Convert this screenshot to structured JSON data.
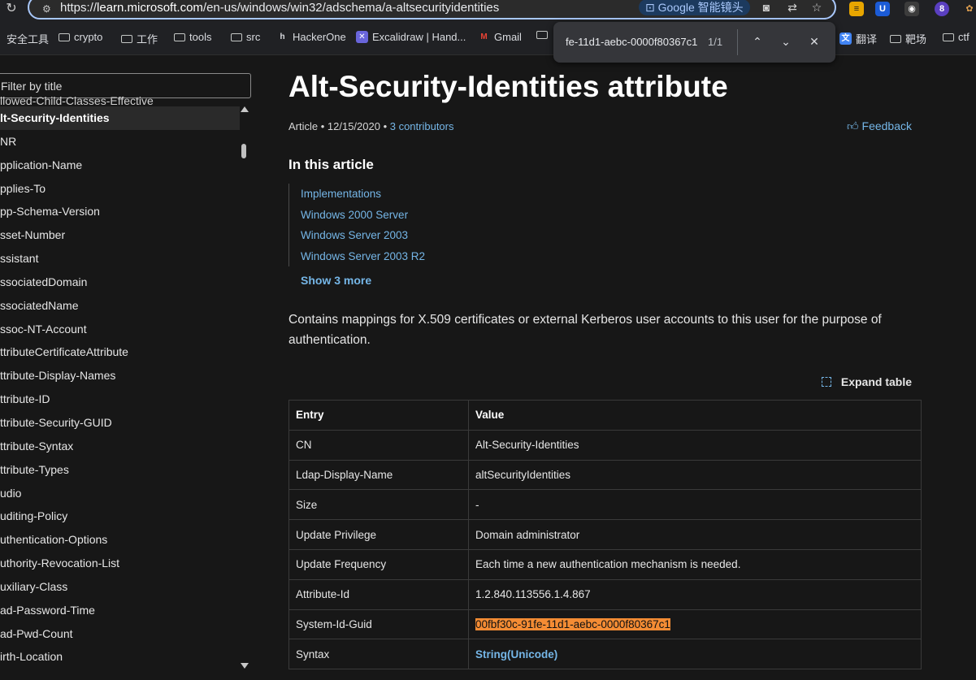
{
  "browser": {
    "url_prefix": "https://",
    "url_host": "learn.microsoft.com",
    "url_path": "/en-us/windows/win32/adschema/a-altsecurityidentities",
    "lens_label": "Google 智能镜头",
    "extension_badge": "8",
    "bookmarks": [
      {
        "label": "安全工具",
        "type": "text"
      },
      {
        "label": "crypto",
        "type": "folder"
      },
      {
        "label": "工作",
        "type": "folder"
      },
      {
        "label": "tools",
        "type": "folder"
      },
      {
        "label": "src",
        "type": "folder"
      },
      {
        "label": "HackerOne",
        "type": "h1"
      },
      {
        "label": "Excalidraw | Hand...",
        "type": "excalidraw"
      },
      {
        "label": "Gmail",
        "type": "gmail"
      },
      {
        "label": "",
        "type": "folder"
      },
      {
        "label": "翻译",
        "type": "translate"
      },
      {
        "label": "靶场",
        "type": "folder"
      },
      {
        "label": "ctf",
        "type": "folder"
      }
    ]
  },
  "find": {
    "query": "fe-11d1-aebc-0000f80367c1",
    "count": "1/1"
  },
  "toc": {
    "filter_placeholder": "Filter by title",
    "top_partial": "llowed-Child-Classes-Effective",
    "items": [
      {
        "label": "lt-Security-Identities",
        "active": true
      },
      {
        "label": "NR"
      },
      {
        "label": "pplication-Name"
      },
      {
        "label": "pplies-To"
      },
      {
        "label": "pp-Schema-Version"
      },
      {
        "label": "sset-Number"
      },
      {
        "label": "ssistant"
      },
      {
        "label": "ssociatedDomain"
      },
      {
        "label": "ssociatedName"
      },
      {
        "label": "ssoc-NT-Account"
      },
      {
        "label": "ttributeCertificateAttribute"
      },
      {
        "label": "ttribute-Display-Names"
      },
      {
        "label": "ttribute-ID"
      },
      {
        "label": "ttribute-Security-GUID"
      },
      {
        "label": "ttribute-Syntax"
      },
      {
        "label": "ttribute-Types"
      },
      {
        "label": "udio"
      },
      {
        "label": "uditing-Policy"
      },
      {
        "label": "uthentication-Options"
      },
      {
        "label": "uthority-Revocation-List"
      },
      {
        "label": "uxiliary-Class"
      },
      {
        "label": "ad-Password-Time"
      },
      {
        "label": "ad-Pwd-Count"
      },
      {
        "label": "irth-Location"
      }
    ]
  },
  "article": {
    "title": "Alt-Security-Identities attribute",
    "meta_prefix": "Article • 12/15/2020 • ",
    "contributors": "3 contributors",
    "feedback": "Feedback",
    "in_this_article": "In this article",
    "toc_links": [
      "Implementations",
      "Windows 2000 Server",
      "Windows Server 2003",
      "Windows Server 2003 R2"
    ],
    "show_more": "Show 3 more",
    "description": "Contains mappings for X.509 certificates or external Kerberos user accounts to this user for the purpose of authentication.",
    "expand_table": "Expand table",
    "table": {
      "headers": [
        "Entry",
        "Value"
      ],
      "rows": [
        {
          "entry": "CN",
          "value": "Alt-Security-Identities"
        },
        {
          "entry": "Ldap-Display-Name",
          "value": "altSecurityIdentities"
        },
        {
          "entry": "Size",
          "value": "-"
        },
        {
          "entry": "Update Privilege",
          "value": "Domain administrator"
        },
        {
          "entry": "Update Frequency",
          "value": "Each time a new authentication mechanism is needed."
        },
        {
          "entry": "Attribute-Id",
          "value": "1.2.840.113556.1.4.867"
        },
        {
          "entry": "System-Id-Guid",
          "value": "00fbf30c-91fe-11d1-aebc-0000f80367c1",
          "highlight": true
        },
        {
          "entry": "Syntax",
          "value": "String(Unicode)",
          "link": true
        }
      ]
    }
  },
  "colors": {
    "link": "#75b6e7",
    "find_highlight": "#f48c34",
    "omnibox_border": "#a8c7fa"
  }
}
